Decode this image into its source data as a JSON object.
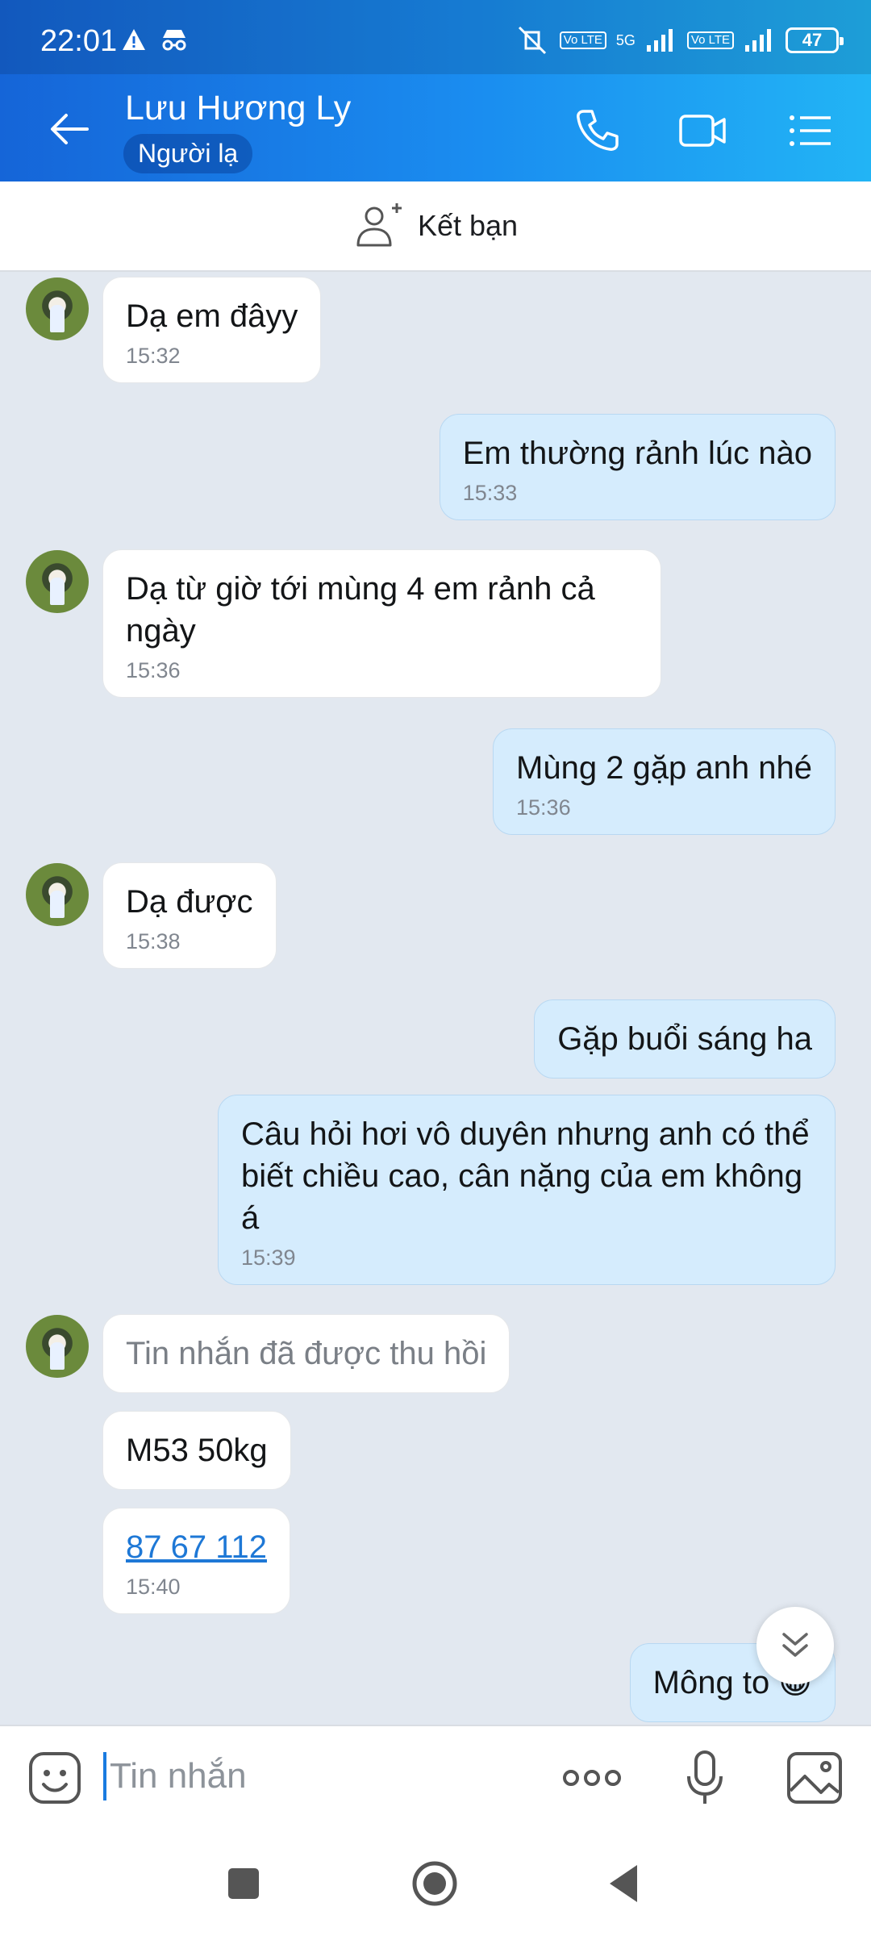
{
  "status": {
    "time": "22:01",
    "network": "5G",
    "volte1": "Vo LTE",
    "volte2": "Vo LTE",
    "battery": "47"
  },
  "header": {
    "contact_name": "Lưu Hương Ly",
    "contact_status": "Người lạ"
  },
  "friend_bar": {
    "label": "Kết bạn"
  },
  "messages": [
    {
      "side": "in",
      "text": "Dạ em đâyy",
      "time": "15:32"
    },
    {
      "side": "out",
      "text": "Em thường rảnh lúc nào",
      "time": "15:33"
    },
    {
      "side": "in",
      "text": "Dạ từ giờ tới mùng 4 em rảnh cả ngày",
      "time": "15:36"
    },
    {
      "side": "out",
      "text": "Mùng 2 gặp anh nhé",
      "time": "15:36"
    },
    {
      "side": "in",
      "text": "Dạ được",
      "time": "15:38"
    },
    {
      "side": "out",
      "text": "Gặp buổi sáng ha",
      "time": ""
    },
    {
      "side": "out",
      "text": "Câu hỏi hơi vô duyên nhưng anh có thể biết chiều cao, cân nặng của em không á",
      "time": "15:39"
    },
    {
      "side": "in",
      "text": "Tin nhắn đã được thu hồi",
      "time": ""
    },
    {
      "side": "in",
      "text": "M53 50kg",
      "time": ""
    },
    {
      "side": "in",
      "text": "87 67 112",
      "time": "15:40"
    },
    {
      "side": "out",
      "text": "Mông to 😀",
      "time": ""
    }
  ],
  "input": {
    "placeholder": "Tin nhắn"
  }
}
